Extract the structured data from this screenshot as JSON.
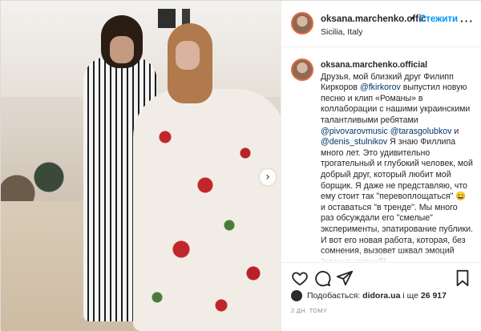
{
  "header": {
    "username": "oksana.marchenko.offic",
    "separator": "•",
    "follow_label": "Стежити",
    "location": "Sicilia, Italy",
    "more_label": "···"
  },
  "caption": {
    "username": "oksana.marchenko.official",
    "part1": "Друзья, мой близкий друг Филипп Киркоров ",
    "tag1": "@fkirkorov",
    "part2": " выпустил новую песню и клип «Романы» в коллаборации с нашими украинскими талантливыми ребятами ",
    "tag2": "@pivovarovmusic",
    "part3": " ",
    "tag3": "@tarasgolubkov",
    "part4": " и ",
    "tag4": "@denis_stulnikov",
    "part5": " Я знаю Филлипа много лет. Это удивительно трогательный и глубокий человек, мой добрый друг, который любит мой борщик. Я даже не представляю, что ему стоит так \"перевоплощаться\" 😄 и оставаться \"в тренде\". Мы много раз обсуждали его \"смелые\" эксперименты, эпатирование публики. И вот его новая работа, которая, без сомнения, вызовет шквал эмоций (разных эмоций)..."
  },
  "likes": {
    "prefix": "Подобається: ",
    "user": "didora.ua",
    "middle": " і ще ",
    "count": "26 917"
  },
  "timestamp": "2 ДН. ТОМУ",
  "photo": {
    "next_label": "›"
  },
  "icons": {
    "like": "heart-icon",
    "comment": "comment-icon",
    "share": "share-icon",
    "save": "bookmark-icon"
  }
}
